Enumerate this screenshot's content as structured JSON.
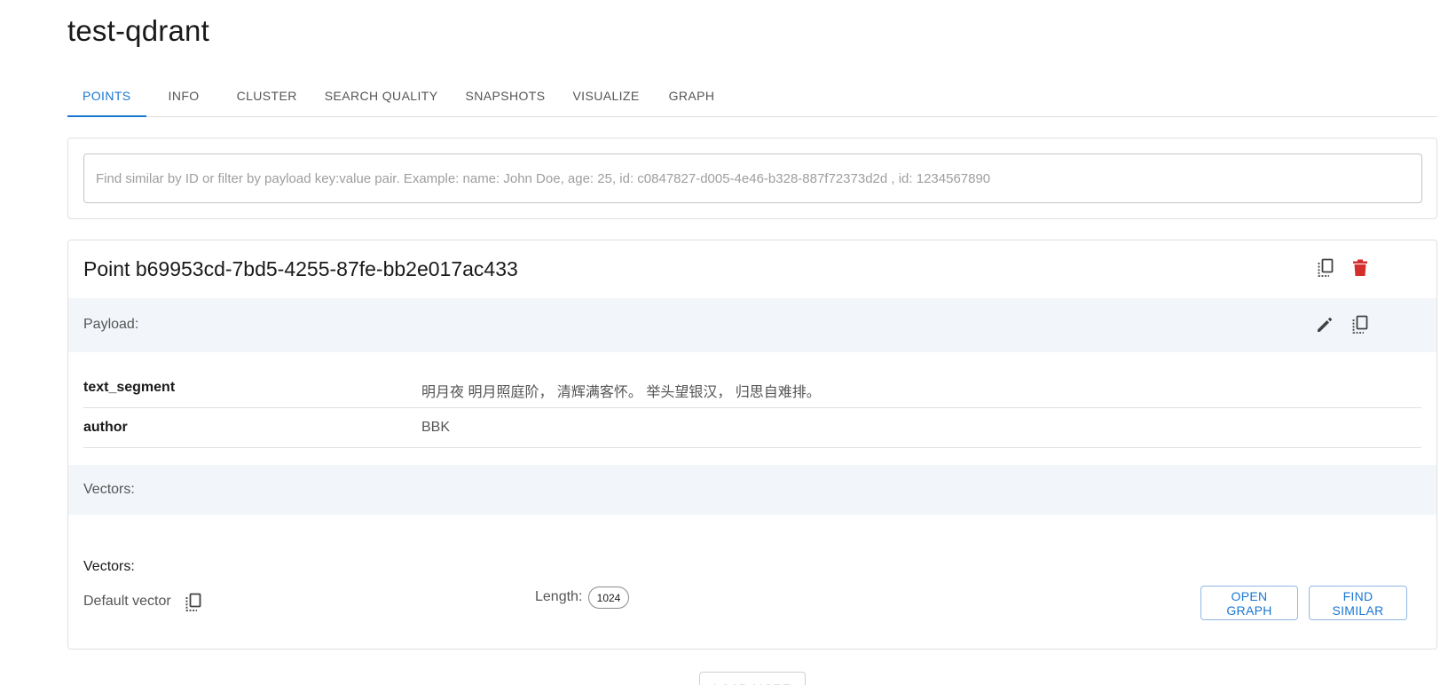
{
  "collection": {
    "title": "test-qdrant"
  },
  "tabs": [
    {
      "label": "POINTS",
      "active": true
    },
    {
      "label": "INFO",
      "active": false
    },
    {
      "label": "CLUSTER",
      "active": false
    },
    {
      "label": "SEARCH QUALITY",
      "active": false
    },
    {
      "label": "SNAPSHOTS",
      "active": false
    },
    {
      "label": "VISUALIZE",
      "active": false
    },
    {
      "label": "GRAPH",
      "active": false
    }
  ],
  "search": {
    "value": "",
    "placeholder": "Find similar by ID or filter by payload key:value pair. Example: name: John Doe, age: 25, id: c0847827-d005-4e46-b328-887f72373d2d , id: 1234567890"
  },
  "point": {
    "title": "Point b69953cd-7bd5-4255-87fe-bb2e017ac433",
    "payload_label": "Payload:",
    "payload": [
      {
        "key": "text_segment",
        "value": "明月夜 明月照庭阶， 清辉满客怀。 举头望银汉， 归思自难排。"
      },
      {
        "key": "author",
        "value": "BBK"
      }
    ],
    "vectors_band_label": "Vectors:",
    "vectors_heading": "Vectors:",
    "vector": {
      "name": "Default vector",
      "length_label": "Length:",
      "length": "1024"
    },
    "actions": {
      "open_graph": "OPEN GRAPH",
      "find_similar": "FIND SIMILAR"
    }
  },
  "load_more": "LOAD MORE",
  "colors": {
    "accent": "#1976d2",
    "delete": "#d32f2f",
    "band_bg": "#f2f6fa",
    "icon": "#424242"
  },
  "icons": {
    "copy": "copy-icon",
    "delete": "delete-icon",
    "edit": "edit-icon"
  }
}
